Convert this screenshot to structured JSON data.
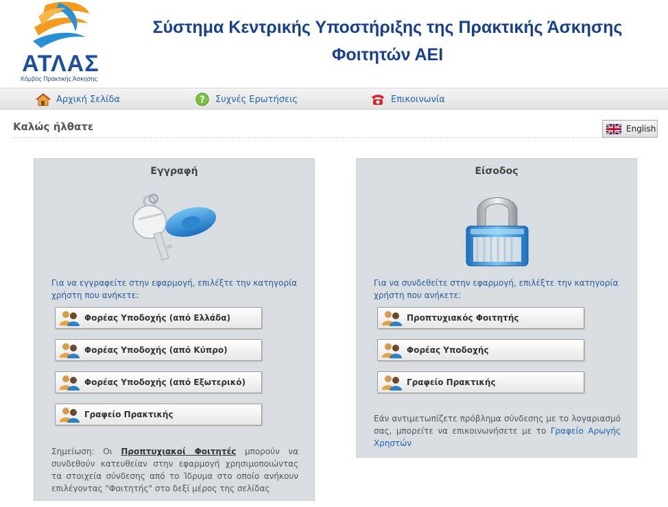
{
  "brand": {
    "logo_text": "ΑΤΛΑΣ",
    "logo_subtitle": "Κόμβος Πρακτικής Άσκησης",
    "title_line1": "Σύστημα Κεντρικής Υποστήριξης της Πρακτικής Άσκησης",
    "title_line2": "Φοιτητών ΑΕΙ",
    "primary_color": "#17418c"
  },
  "nav": {
    "items": [
      {
        "label": "Αρχική Σελίδα",
        "icon": "home-icon"
      },
      {
        "label": "Συχνές Ερωτήσεις",
        "icon": "help-icon"
      },
      {
        "label": "Επικοινωνία",
        "icon": "phone-icon"
      }
    ]
  },
  "welcome": {
    "title": "Καλώς ήλθατε",
    "language_button": "English",
    "language_icon": "uk-flag-icon"
  },
  "register": {
    "title": "Εγγραφή",
    "icon": "key-icon",
    "intro": "Για να εγγραφείτε στην εφαρμογή, επιλέξτε την κατηγορία χρήστη που ανήκετε:",
    "buttons": [
      {
        "label": "Φορέας Υποδοχής (από Ελλάδα)"
      },
      {
        "label": "Φορέας Υποδοχής (από Κύπρο)"
      },
      {
        "label": "Φορέας Υποδοχής (από Εξωτερικό)"
      },
      {
        "label": "Γραφείο Πρακτικής"
      }
    ],
    "note_prefix": "Σημείωση: Οι ",
    "note_link": "Προπτυχιακοί Φοιτητές",
    "note_suffix": " μπορούν να συνδεθούν κατευθείαν στην εφαρμογή χρησιμοποιώντας τα στοιχεία σύνδεσης από το Ίδρυμα στο οποίο ανήκουν επιλέγοντας \"Φοιτητής\" στο δεξί μέρος της σελίδας"
  },
  "login": {
    "title": "Είσοδος",
    "icon": "padlock-icon",
    "intro": "Για να συνδεθείτε στην εφαρμογή, επιλέξτε την κατηγορία χρήστη που ανήκετε:",
    "buttons": [
      {
        "label": "Προπτυχιακός Φοιτητής"
      },
      {
        "label": "Φορέας Υποδοχής"
      },
      {
        "label": "Γραφείο Πρακτικής"
      }
    ],
    "help_text": "Εάν αντιμετωπίζετε πρόβλημα σύνδεσης με το λογαριασμό σας, μπορείτε να επικοινωνήσετε με το ",
    "help_link": "Γραφείο Αρωγής Χρηστών"
  }
}
